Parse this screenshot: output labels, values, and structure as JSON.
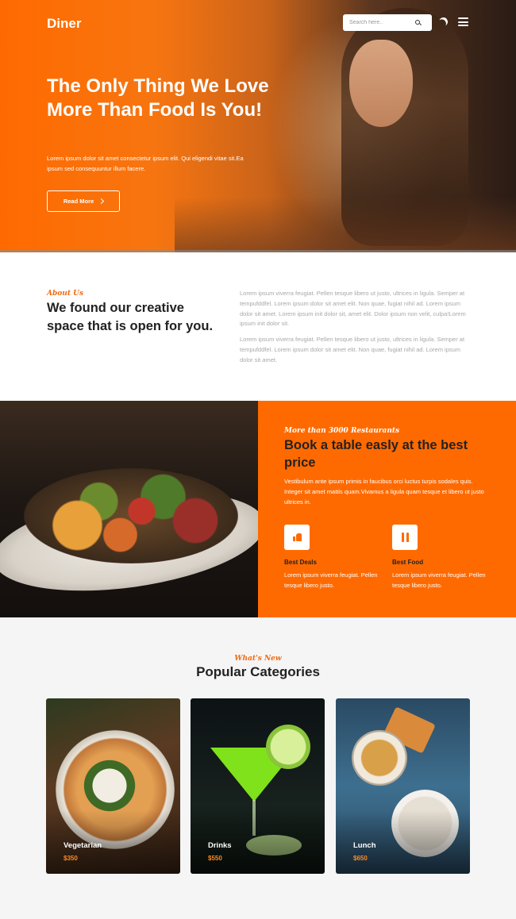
{
  "header": {
    "logo": "Diner",
    "search_placeholder": "Search here..",
    "icons": [
      "search-icon",
      "moon-icon",
      "menu-icon"
    ]
  },
  "hero": {
    "title": "The Only Thing We Love More Than Food Is You!",
    "text": "Lorem ipsum dolor sit amet consectetur ipsum elit. Qui eligendi vitae sit.Ea ipsum sed consequuntur illum facere.",
    "button_label": "Read More"
  },
  "about": {
    "label": "About Us",
    "title": "We found our creative space that is open for you.",
    "paragraph1": "Lorem ipsum viverra feugiat. Pellen tesque libero ut justo, ultrices in ligula. Semper at tempufddfel. Lorem ipsum dolor sit amet elit. Non quae, fugiat nihil ad. Lorem ipsum dolor sit amet. Lorem ipsum init dolor sit, amet elit. Dolor ipsum non velit, culpa!Lorem ipsum init dolor sit.",
    "paragraph2": "Lorem ipsum viverra feugiat. Pellen tesque libero ut justo, ultrices in ligula. Semper at tempufddfel. Lorem ipsum dolor sit amet elit. Non quae, fugiat nihil ad. Lorem ipsum dolor sit amet."
  },
  "booking": {
    "label": "More than 3000 Restaurants",
    "title": "Book a table easly at the best price",
    "text": "Vestibulum ante ipsum primis in faucibus orci luctus turpis sodales quis. Integer sit amet mattis quam.Vivamus a ligula quam tesque et libero ut justo ultrices in.",
    "features": [
      {
        "title": "Best Deals",
        "text": "Lorem ipsum viverra feugiat. Pellen tesque libero justo.",
        "icon": "thumbs-up-icon"
      },
      {
        "title": "Best Food",
        "text": "Lorem ipsum viverra feugiat. Pellen tesque libero justo.",
        "icon": "cutlery-icon"
      }
    ]
  },
  "categories": {
    "label": "What's New",
    "title": "Popular Categories",
    "items": [
      {
        "name": "Vegetarian",
        "price": "$350"
      },
      {
        "name": "Drinks",
        "price": "$550"
      },
      {
        "name": "Lunch",
        "price": "$650"
      }
    ]
  },
  "colors": {
    "accent": "#ff6a00",
    "price": "#ff8a1c",
    "section_bg": "#f5f5f5"
  }
}
